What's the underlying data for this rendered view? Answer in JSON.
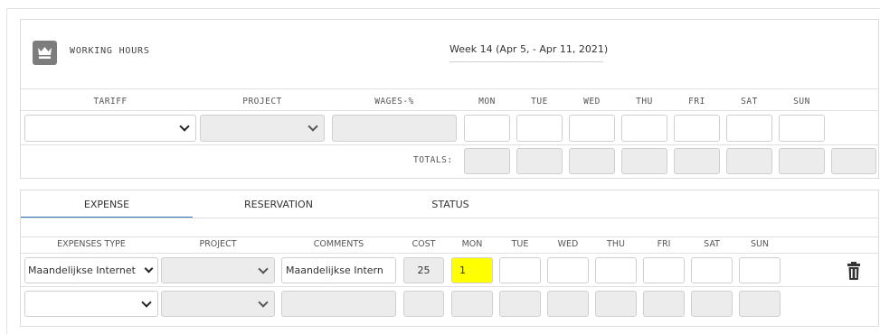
{
  "working_hours": {
    "title": "WORKING HOURS",
    "icon": "crown-icon",
    "week_label": "Week 14 (Apr 5, - Apr 11, 2021)",
    "columns": {
      "tariff": "TARIFF",
      "project": "PROJECT",
      "wages": "WAGES-%",
      "mon": "MON",
      "tue": "TUE",
      "wed": "WED",
      "thu": "THU",
      "fri": "FRI",
      "sat": "SAT",
      "sun": "SUN"
    },
    "totals_label": "TOTALS:"
  },
  "expense_section": {
    "tabs": [
      "EXPENSE",
      "RESERVATION",
      "STATUS"
    ],
    "active_tab": "EXPENSE",
    "columns": {
      "expenses_type": "EXPENSES TYPE",
      "project": "PROJECT",
      "comments": "COMMENTS",
      "cost": "COST",
      "mon": "MON",
      "tue": "TUE",
      "wed": "WED",
      "thu": "THU",
      "fri": "FRI",
      "sat": "SAT",
      "sun": "SUN"
    },
    "row1": {
      "expenses_type": "Maandelijkse Internet",
      "comments": "Maandelijkse Intern",
      "cost": "25",
      "mon": "1"
    },
    "highlight_color": "#ffff00",
    "tab_accent_color": "#2f6fb5"
  }
}
